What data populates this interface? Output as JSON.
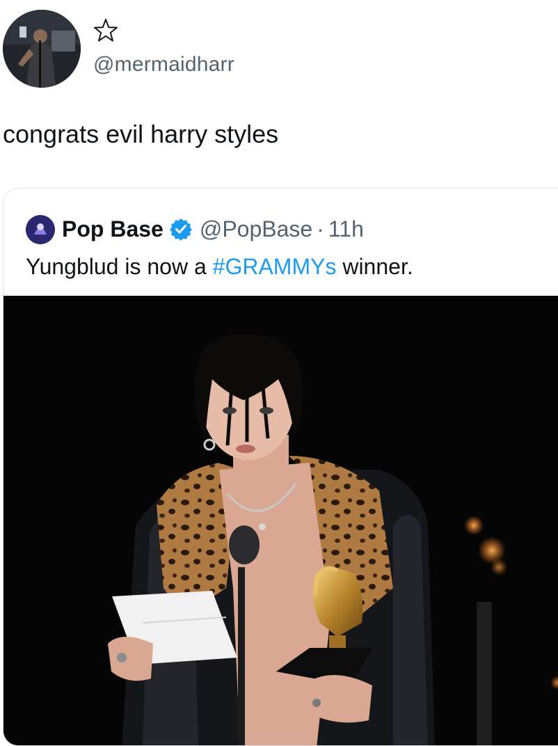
{
  "tweet": {
    "author_handle": "@mermaidharr",
    "text": "congrats evil harry styles",
    "favorite_icon": "star-outline-icon"
  },
  "quoted_tweet": {
    "author_name": "Pop Base",
    "author_handle": "@PopBase",
    "separator": "·",
    "time": "11h",
    "text_before": "Yungblud is now a ",
    "hashtag": "#GRAMMYs",
    "text_after": " winner.",
    "verified": true,
    "verified_color": "#1d9bf0",
    "hashtag_color": "#1d9bf0",
    "media_icon": "photo"
  }
}
